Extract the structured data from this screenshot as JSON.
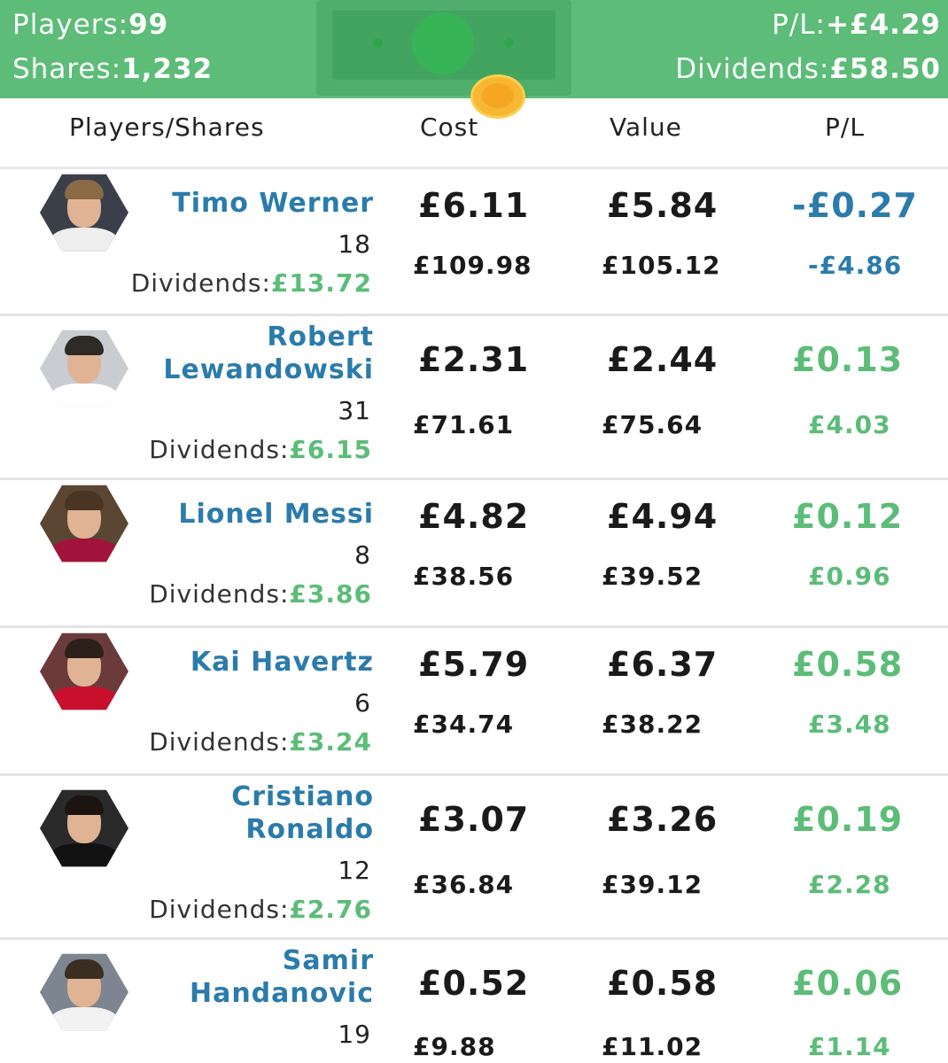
{
  "summary": {
    "players_label": "Players:",
    "players_value": "99",
    "shares_label": "Shares:",
    "shares_value": "1,232",
    "pl_label": "P/L:",
    "pl_value": "+£4.29",
    "dividends_label": "Dividends:",
    "dividends_value": "£58.50",
    "icon": "banknote-coin-icon"
  },
  "columns": {
    "players": "Players/Shares",
    "cost": "Cost",
    "value": "Value",
    "pl": "P/L"
  },
  "colors": {
    "header_bg": "#5cbc78",
    "positive": "#5cbc78",
    "negative": "#2b7bab",
    "name": "#2b7bab"
  },
  "dividends_label": "Dividends:",
  "holdings": [
    {
      "name_line1": "Timo Werner",
      "name_line2": "",
      "shares": "18",
      "dividends": "£13.72",
      "cost": "£6.11",
      "value": "£5.84",
      "pl": "-£0.27",
      "cost_total": "£109.98",
      "value_total": "£105.12",
      "pl_total": "-£4.86",
      "pl_sign": "negative",
      "avatar": "player-avatar"
    },
    {
      "name_line1": "Robert",
      "name_line2": "Lewandowski",
      "shares": "31",
      "dividends": "£6.15",
      "cost": "£2.31",
      "value": "£2.44",
      "pl": "£0.13",
      "cost_total": "£71.61",
      "value_total": "£75.64",
      "pl_total": "£4.03",
      "pl_sign": "positive",
      "avatar": "player-avatar"
    },
    {
      "name_line1": "Lionel Messi",
      "name_line2": "",
      "shares": "8",
      "dividends": "£3.86",
      "cost": "£4.82",
      "value": "£4.94",
      "pl": "£0.12",
      "cost_total": "£38.56",
      "value_total": "£39.52",
      "pl_total": "£0.96",
      "pl_sign": "positive",
      "avatar": "player-avatar"
    },
    {
      "name_line1": "Kai Havertz",
      "name_line2": "",
      "shares": "6",
      "dividends": "£3.24",
      "cost": "£5.79",
      "value": "£6.37",
      "pl": "£0.58",
      "cost_total": "£34.74",
      "value_total": "£38.22",
      "pl_total": "£3.48",
      "pl_sign": "positive",
      "avatar": "player-avatar"
    },
    {
      "name_line1": "Cristiano",
      "name_line2": "Ronaldo",
      "shares": "12",
      "dividends": "£2.76",
      "cost": "£3.07",
      "value": "£3.26",
      "pl": "£0.19",
      "cost_total": "£36.84",
      "value_total": "£39.12",
      "pl_total": "£2.28",
      "pl_sign": "positive",
      "avatar": "player-avatar"
    },
    {
      "name_line1": "Samir",
      "name_line2": "Handanovic",
      "shares": "19",
      "dividends": "",
      "cost": "£0.52",
      "value": "£0.58",
      "pl": "£0.06",
      "cost_total": "£9.88",
      "value_total": "£11.02",
      "pl_total": "£1.14",
      "pl_sign": "positive",
      "avatar": "player-avatar"
    }
  ]
}
